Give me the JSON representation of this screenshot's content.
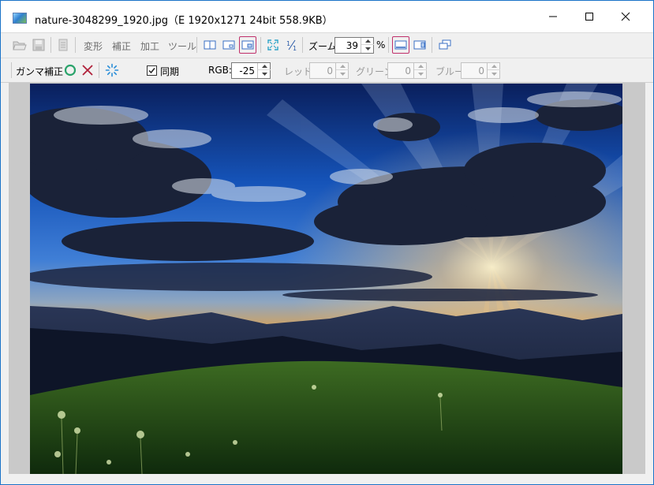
{
  "window": {
    "title": "nature-3048299_1920.jpg（E  1920x1271  24bit  558.9KB）",
    "controls": {
      "minimize": "minimize",
      "maximize": "maximize",
      "close": "close"
    }
  },
  "toolbar1": {
    "menus": [
      "変形",
      "補正",
      "加工",
      "ツール"
    ],
    "zoom_label": "ズーム:",
    "zoom_value": "39",
    "zoom_unit": "%"
  },
  "toolbar2": {
    "mode_label": "ガンマ補正",
    "sync_label": "同期",
    "sync_checked": true,
    "rgb_label": "RGB:",
    "rgb_value": "-25",
    "red_label": "レッド:",
    "red_value": "0",
    "green_label": "グリーン:",
    "green_value": "0",
    "blue_label": "ブルー:",
    "blue_value": "0"
  },
  "colors": {
    "accent_blue": "#1a73c8",
    "selection_border": "#c0306a",
    "apply_green": "#2aa36b",
    "cancel_red": "#b0203a",
    "disabled_text": "#9a9a9a"
  },
  "icons": {
    "open": "folder-open-icon",
    "save": "save-icon",
    "page": "page-icon",
    "split_view": "split-view-icon",
    "layout_a": "layout-a-icon",
    "layout_b": "layout-b-icon",
    "fit": "fit-window-icon",
    "actual": "actual-size-icon",
    "panel_a": "panel-a-icon",
    "panel_b": "panel-b-icon",
    "window_mode": "window-mode-icon",
    "apply": "apply-circle-icon",
    "cancel": "cancel-x-icon",
    "preview": "preview-sparkle-icon"
  }
}
